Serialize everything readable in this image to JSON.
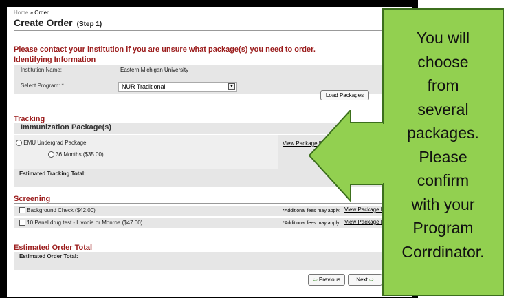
{
  "breadcrumb": {
    "home": "Home",
    "sep": " » ",
    "current": "Order"
  },
  "page": {
    "title": "Create Order",
    "step": "(Step 1)"
  },
  "notice": "Please contact your institution if you are unsure what package(s) you need to order.",
  "identifying": {
    "heading": "Identifying Information",
    "institution_label": "Institution Name:",
    "institution_value": "Eastern Michigan University",
    "program_label": "Select Program: *",
    "program_value": "NUR Traditional",
    "load_button": "Load Packages"
  },
  "tracking": {
    "heading": "Tracking",
    "subheading": "Immunization Package(s)",
    "package_label": "EMU Undergrad Package",
    "package_link": "View Package D",
    "option_label": "36 Months ($35.00)",
    "total_label": "Estimated Tracking Total:"
  },
  "screening": {
    "heading": "Screening",
    "items": [
      {
        "label": "Background Check ($42.00)",
        "fees": "*Additional fees may apply.",
        "link": "View Package D"
      },
      {
        "label": "10 Panel drug test - Livonia or Monroe ($47.00)",
        "fees": "*Additional fees may apply.",
        "link": "View Package D"
      }
    ]
  },
  "order_total": {
    "heading": "Estimated Order Total",
    "label": "Estimated Order Total:"
  },
  "nav": {
    "previous": "Previous",
    "next": "Next"
  },
  "callout": {
    "text": "You will\nchoose\nfrom\nseveral\npackages.\nPlease\nconfirm\nwith your\nProgram\nCorrdinator.",
    "fill": "#92d050",
    "border": "#3c6f1d"
  },
  "colors": {
    "section_red": "#9b1c1c",
    "gray_panel": "#e6e6e6"
  }
}
